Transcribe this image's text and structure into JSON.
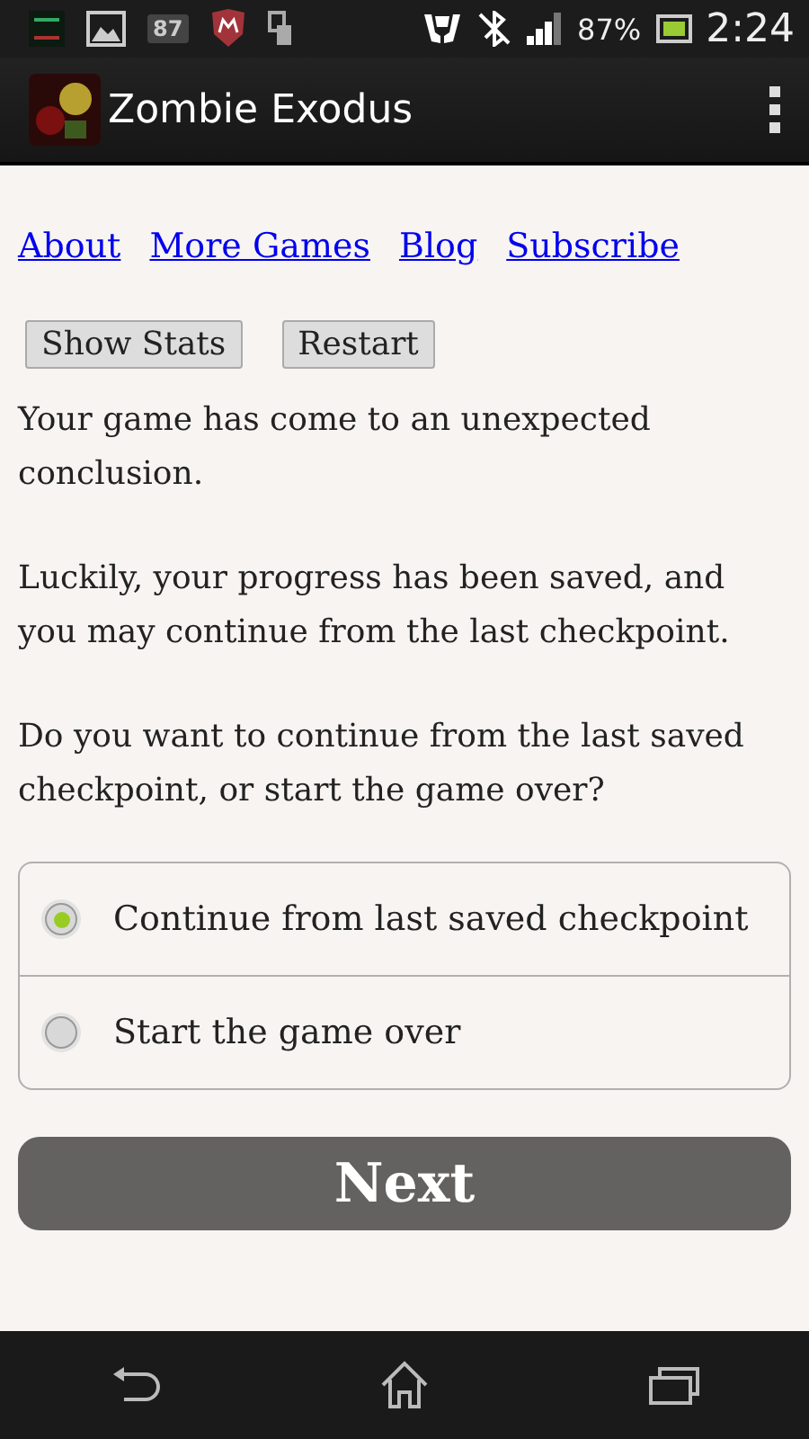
{
  "status_bar": {
    "badge": "87",
    "battery": "87%",
    "time": "2:24"
  },
  "app_bar": {
    "title": "Zombie Exodus"
  },
  "links": [
    "About",
    "More Games",
    "Blog",
    "Subscribe"
  ],
  "buttons": [
    "Show Stats",
    "Restart"
  ],
  "paragraphs": [
    "Your game has come to an unexpected conclusion.",
    "Luckily, your progress has been saved, and you may continue from the last checkpoint.",
    "Do you want to continue from the last saved checkpoint, or start the game over?"
  ],
  "options": [
    {
      "label": "Continue from last saved checkpoint",
      "selected": true
    },
    {
      "label": "Start the game over",
      "selected": false
    }
  ],
  "next_button": "Next"
}
